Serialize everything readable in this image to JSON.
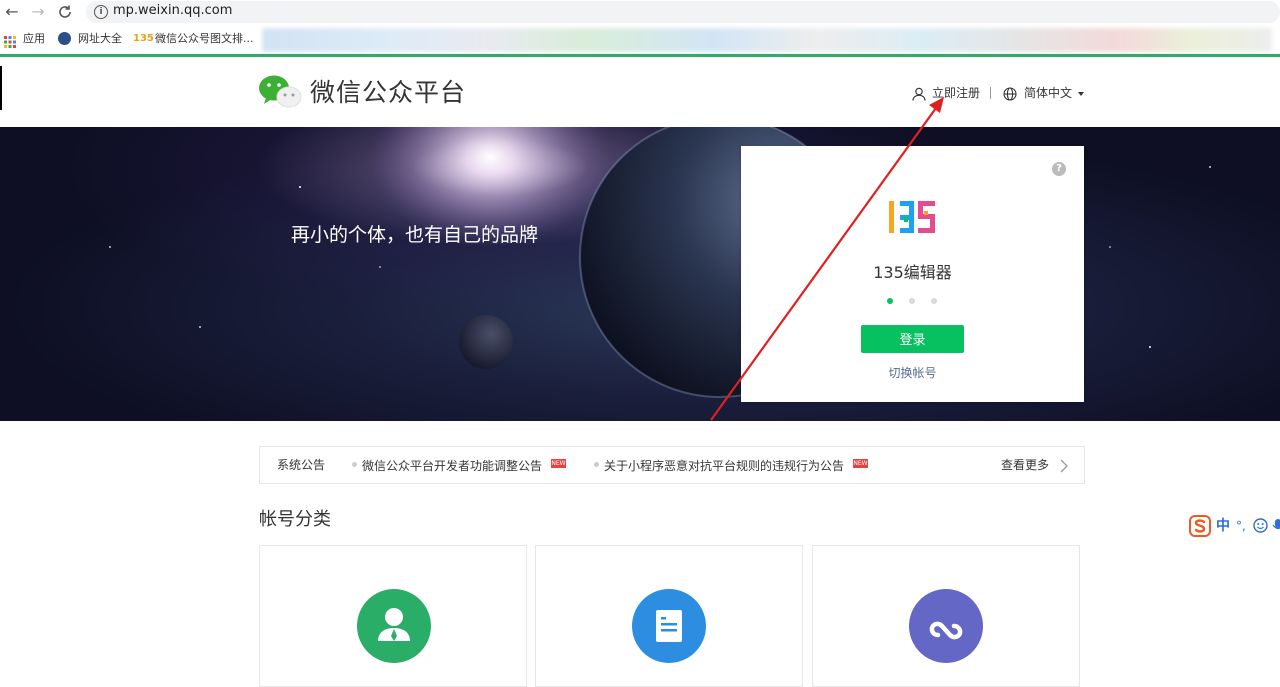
{
  "browser": {
    "url": "mp.weixin.qq.com",
    "bookmarks": [
      {
        "label": "应用"
      },
      {
        "label": "网址大全"
      },
      {
        "label": "微信公众号图文排..."
      }
    ]
  },
  "header": {
    "title": "微信公众平台",
    "register_label": "立即注册",
    "language_label": "简体中文"
  },
  "banner": {
    "slogan": "再小的个体，也有自己的品牌"
  },
  "login_card": {
    "account_logo_text": "135",
    "account_name": "135编辑器",
    "login_button": "登录",
    "switch_account": "切换帐号",
    "help_glyph": "?",
    "carousel_total": 3,
    "carousel_active": 1
  },
  "notices": {
    "label": "系统公告",
    "items": [
      {
        "text": "微信公众平台开发者功能调整公告",
        "badge": "NEW"
      },
      {
        "text": "关于小程序恶意对抗平台规则的违规行为公告",
        "badge": "NEW"
      }
    ],
    "more_label": "查看更多"
  },
  "account_types": {
    "title": "帐号分类",
    "items": [
      {
        "icon": "service-account-icon",
        "color": "#2aae67"
      },
      {
        "icon": "subscription-account-icon",
        "color": "#2d8de0"
      },
      {
        "icon": "mini-program-icon",
        "color": "#6467c5"
      }
    ]
  },
  "ime": {
    "lang": "中",
    "punct": "°,"
  },
  "colors": {
    "brand_green": "#07c160",
    "link_blue": "#576b95",
    "annotation_red": "#e02020"
  }
}
